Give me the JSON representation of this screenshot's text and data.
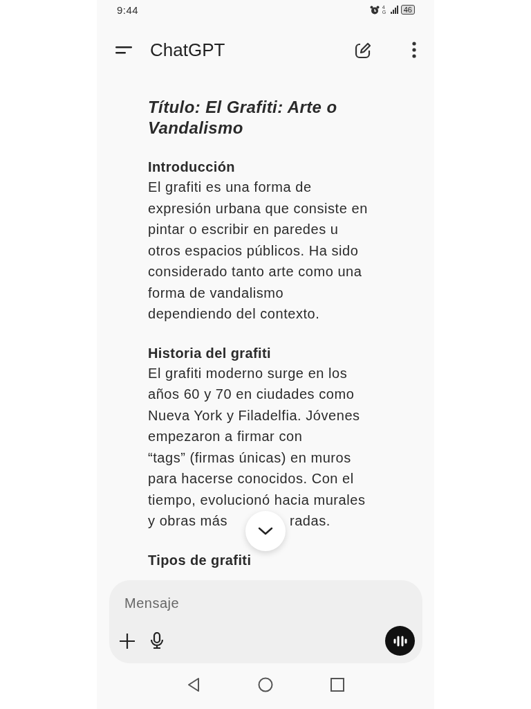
{
  "status_bar": {
    "time": "9:44",
    "network": "4G",
    "battery": "46"
  },
  "header": {
    "title": "ChatGPT"
  },
  "message": {
    "title": "Título: El Grafiti: Arte o Vandalismo",
    "sections": [
      {
        "heading": "Introducción",
        "lines": [
          "El grafiti es una forma de",
          "expresión urbana que consiste en",
          "pintar o escribir en paredes u",
          "otros espacios públicos. Ha sido",
          "considerado tanto arte como una",
          "forma de vandalismo",
          "dependiendo del contexto."
        ]
      },
      {
        "heading": "Historia del grafiti",
        "lines": [
          "El grafiti moderno surge en los",
          "años 60 y 70 en ciudades como",
          "Nueva York y Filadelfia. Jóvenes",
          "empezaron a firmar con",
          "“tags” (firmas únicas) en muros",
          "para hacerse conocidos. Con el",
          "tiempo, evolucionó hacia murales",
          "y obras más"
        ],
        "tail_fragment": "radas."
      },
      {
        "heading": "Tipos de grafiti"
      }
    ]
  },
  "composer": {
    "placeholder": "Mensaje"
  }
}
